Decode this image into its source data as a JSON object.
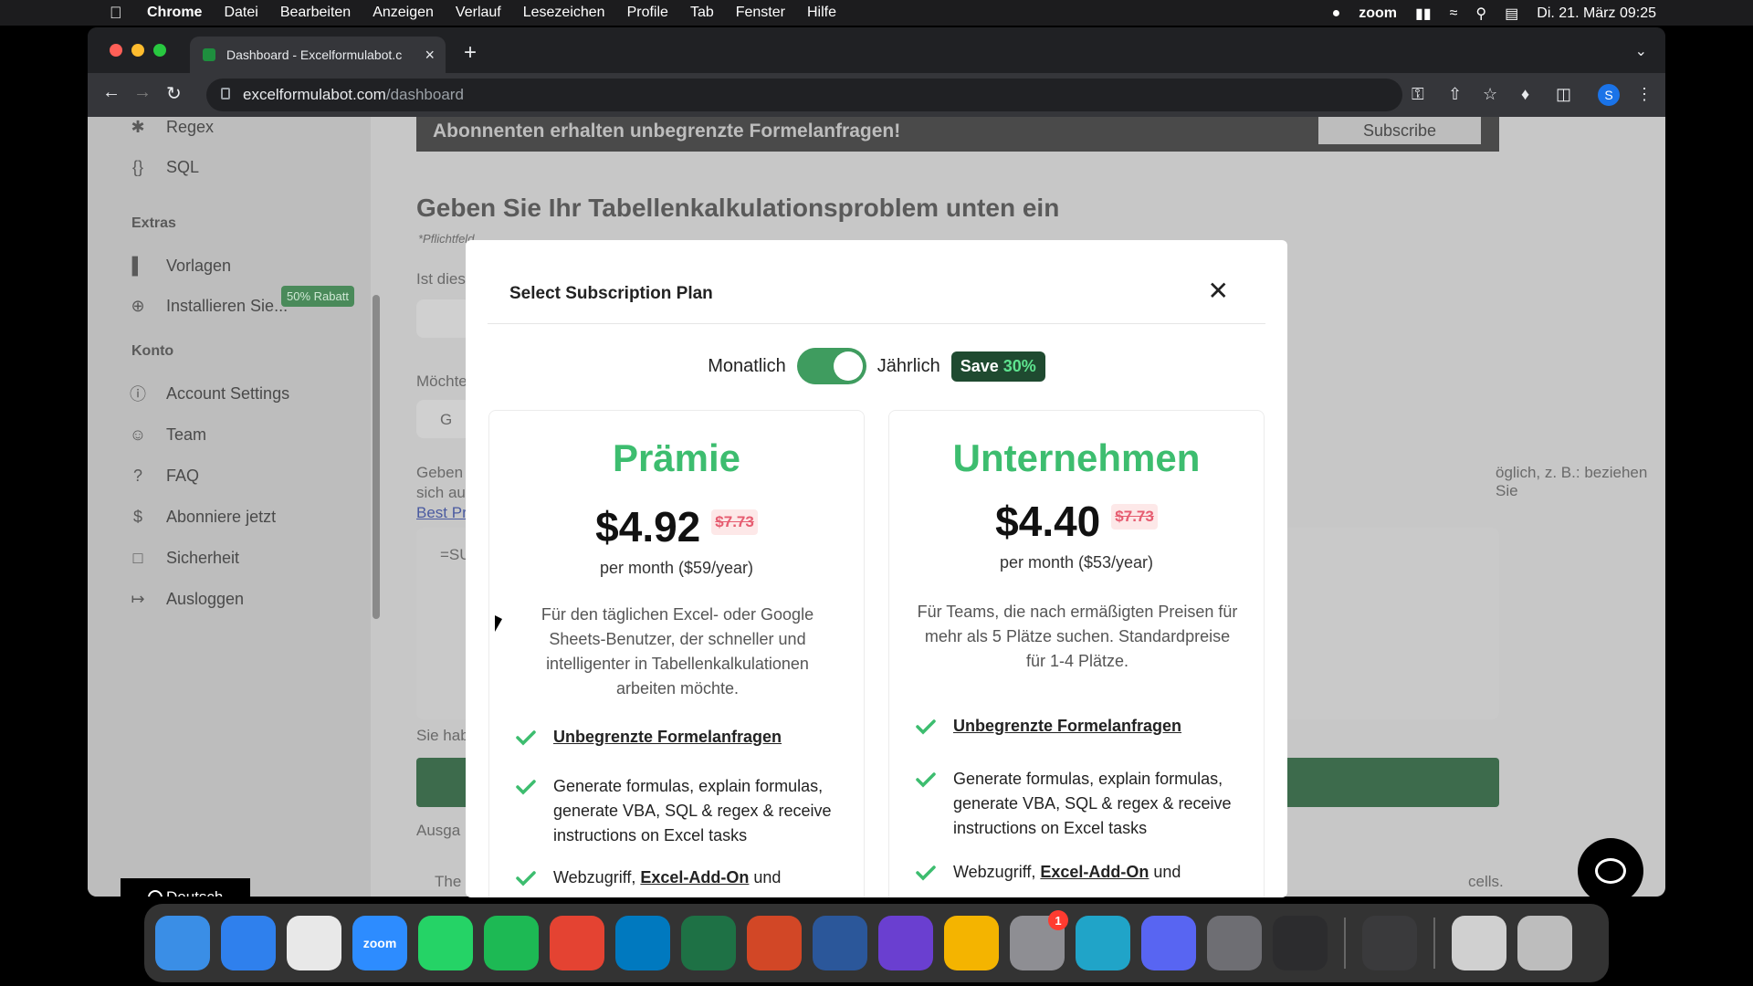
{
  "menubar": {
    "app": "Chrome",
    "items": [
      "Datei",
      "Bearbeiten",
      "Anzeigen",
      "Verlauf",
      "Lesezeichen",
      "Profile",
      "Tab",
      "Fenster",
      "Hilfe"
    ],
    "zoom": "zoom",
    "datetime": "Di. 21. März  09:25"
  },
  "browser": {
    "tab_title": "Dashboard - Excelformulabot.c",
    "url_domain": "excelformulabot.com",
    "url_path": "/dashboard",
    "profile_initial": "S"
  },
  "sidebar": {
    "items_top": [
      {
        "icon": "asterisk-icon",
        "label": "Regex"
      },
      {
        "icon": "braces-icon",
        "label": "SQL"
      }
    ],
    "extras_heading": "Extras",
    "extras": [
      {
        "icon": "bar-chart-icon",
        "label": "Vorlagen",
        "badge": "50% Rabatt"
      },
      {
        "icon": "plus-circle-icon",
        "label": "Installieren Sie..."
      }
    ],
    "konto_heading": "Konto",
    "konto": [
      {
        "icon": "info-icon",
        "label": "Account Settings"
      },
      {
        "icon": "team-icon",
        "label": "Team"
      },
      {
        "icon": "question-icon",
        "label": "FAQ"
      },
      {
        "icon": "dollar-icon",
        "label": "Abonniere jetzt"
      },
      {
        "icon": "lock-icon",
        "label": "Sicherheit"
      },
      {
        "icon": "logout-icon",
        "label": "Ausloggen"
      }
    ],
    "language": "Deutsch"
  },
  "main": {
    "banner_text": "Abonnenten erhalten unbegrenzte Formelanfragen!",
    "subscribe_label": "Subscribe",
    "title": "Geben Sie Ihr Tabellenkalkulationsproblem unten ein",
    "required_note": "*Pflichtfeld",
    "frag_ist": "Ist dies",
    "frag_moechte": "Möchte",
    "frag_g": "G",
    "frag_geben": "Geben",
    "frag_sich": "sich au",
    "frag_best": "Best Pr",
    "frag_su": "=SU",
    "frag_right": "öglich, z. B.: beziehen Sie",
    "frag_sie_hab": "Sie hab",
    "frag_ausga": "Ausga",
    "frag_the": "The",
    "frag_cells": "cells."
  },
  "modal": {
    "title": "Select Subscription Plan",
    "toggle_left": "Monatlich",
    "toggle_right": "Jährlich",
    "save_prefix": "Save ",
    "save_pct": "30%",
    "plans": [
      {
        "name": "Prämie",
        "price": "$4.92",
        "old_price": "$7.73",
        "per_month": "per month ($59/year)",
        "desc": "Für den täglichen Excel- oder Google Sheets-Benutzer, der schneller und intelligenter in Tabellenkalkulationen arbeiten möchte.",
        "feature1": "Unbegrenzte Formelanfragen",
        "feature2": "Generate formulas, explain formulas, generate VBA, SQL & regex & receive instructions on Excel tasks",
        "feature3_prefix": "Webzugriff, ",
        "feature3_link": "Excel-Add-On",
        "feature3_suffix": " und"
      },
      {
        "name": "Unternehmen",
        "price": "$4.40",
        "old_price": "$7.73",
        "per_month": "per month ($53/year)",
        "desc": "Für Teams, die nach ermäßigten Preisen für mehr als 5 Plätze suchen. Standardpreise für 1-4 Plätze.",
        "feature1": "Unbegrenzte Formelanfragen",
        "feature2": "Generate formulas, explain formulas, generate VBA, SQL & regex & receive instructions on Excel tasks",
        "feature3_prefix": "Webzugriff, ",
        "feature3_link": "Excel-Add-On",
        "feature3_suffix": " und"
      }
    ]
  },
  "dock": {
    "apps": [
      {
        "name": "finder-icon",
        "color": "#3a8ee6"
      },
      {
        "name": "safari-icon",
        "color": "#2f80ed"
      },
      {
        "name": "chrome-icon",
        "color": "#e8e8e8"
      },
      {
        "name": "zoom-icon",
        "color": "#2d8cff"
      },
      {
        "name": "whatsapp-icon",
        "color": "#25d366"
      },
      {
        "name": "spotify-icon",
        "color": "#1db954"
      },
      {
        "name": "todoist-icon",
        "color": "#e44332"
      },
      {
        "name": "trello-icon",
        "color": "#0079bf"
      },
      {
        "name": "excel-icon",
        "color": "#1e7145"
      },
      {
        "name": "powerpoint-icon",
        "color": "#d24726"
      },
      {
        "name": "word-icon",
        "color": "#2b579a"
      },
      {
        "name": "imovie-icon",
        "color": "#6a3fd0"
      },
      {
        "name": "google-drive-icon",
        "color": "#f4b400"
      },
      {
        "name": "system-settings-icon",
        "color": "#8e8e93",
        "badge": "1"
      },
      {
        "name": "browser-icon",
        "color": "#20a4c8"
      },
      {
        "name": "discord-icon",
        "color": "#5865f2"
      },
      {
        "name": "quicktime-icon",
        "color": "#6e6e73"
      },
      {
        "name": "voice-memos-icon",
        "color": "#2c2c2e"
      },
      {
        "name": "calculator-icon",
        "color": "#3a3a3c"
      },
      {
        "name": "downloads-folder-icon",
        "color": "#d0d0d0"
      },
      {
        "name": "trash-icon",
        "color": "#bdbdbd"
      }
    ],
    "zoom_label": "zoom"
  }
}
